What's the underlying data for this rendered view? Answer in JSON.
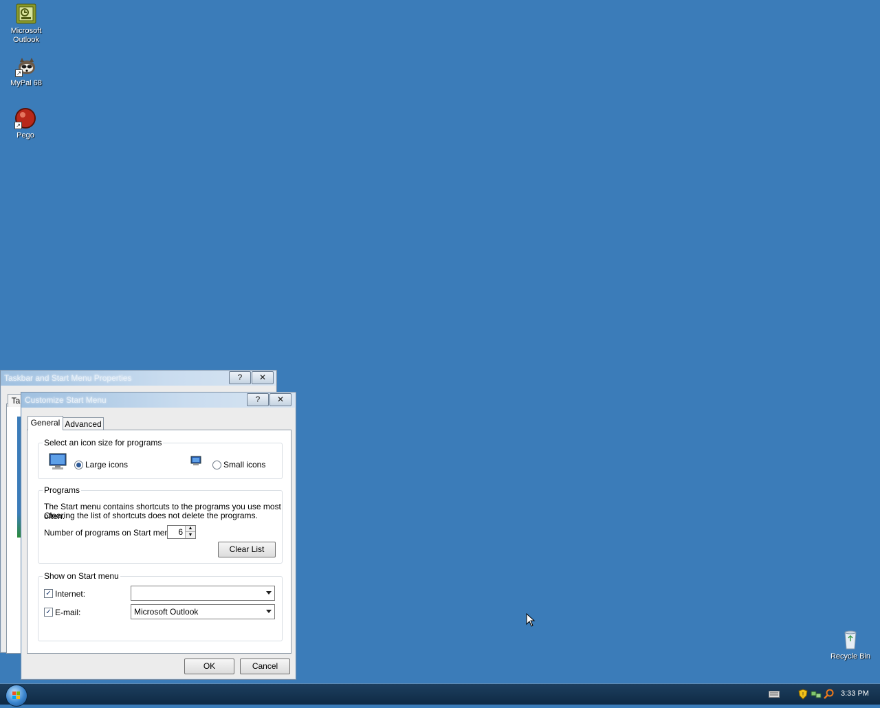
{
  "desktop": {
    "icons": [
      {
        "label": "Microsoft Outlook",
        "icon": "outlook-icon"
      },
      {
        "label": "MyPal 68",
        "icon": "mypal-raccoon-icon"
      },
      {
        "label": "Pego",
        "icon": "pego-icon"
      }
    ],
    "recycle_bin": {
      "label": "Recycle Bin",
      "icon": "recycle-bin-icon"
    }
  },
  "back_window": {
    "title": "Taskbar and Start Menu Properties",
    "tab_partial": "Ta",
    "help_button": "?",
    "close_button": "✕"
  },
  "dialog": {
    "title": "Customize Start Menu",
    "help_button": "?",
    "close_button": "✕",
    "tabs": [
      {
        "label": "General",
        "active": true
      },
      {
        "label": "Advanced",
        "active": false
      }
    ],
    "icon_size": {
      "group_label": "Select an icon size for programs",
      "large_label": "Large icons",
      "small_label": "Small icons",
      "selected": "large"
    },
    "programs": {
      "group_label": "Programs",
      "description_line1": "The Start menu contains shortcuts to the programs you use most often.",
      "description_line2": "Clearing the list of shortcuts does not delete the programs.",
      "count_label": "Number of programs on Start menu:",
      "count_value": "6",
      "clear_button": "Clear List"
    },
    "show_on_start": {
      "group_label": "Show on Start menu",
      "internet_label": "Internet:",
      "internet_checked": true,
      "internet_value": "",
      "email_label": "E-mail:",
      "email_checked": true,
      "email_value": "Microsoft Outlook"
    },
    "ok_button": "OK",
    "cancel_button": "Cancel"
  },
  "taskbar": {
    "clock": "3:33 PM"
  },
  "colors": {
    "desktop": "#3b7cb9",
    "taskbar": "#1a3a58"
  }
}
